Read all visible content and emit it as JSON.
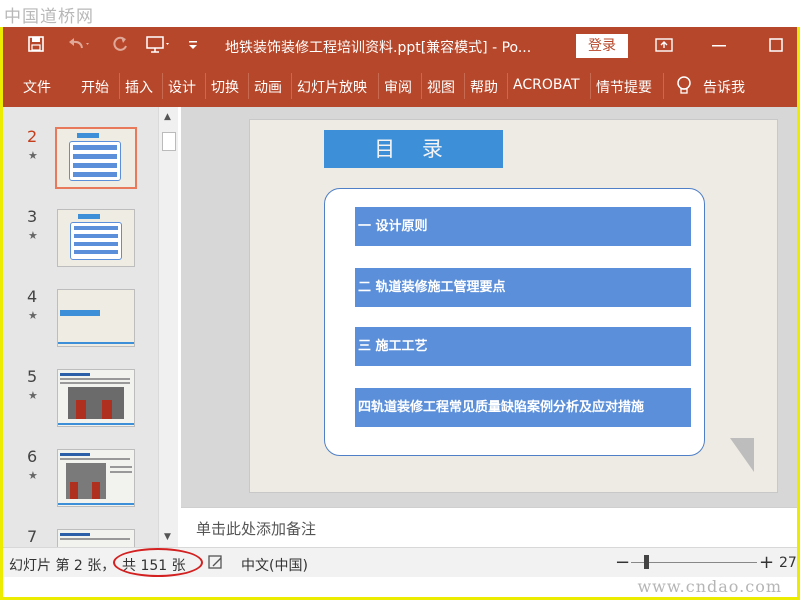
{
  "watermark_top": "中国道桥网",
  "watermark_bottom": "www.cndao.com",
  "titlebar": {
    "doc_title": "地铁装饰装修工程培训资料.ppt[兼容模式]  -  Po...",
    "login_label": "登录"
  },
  "ribbon": {
    "tabs": [
      "文件",
      "开始",
      "插入",
      "设计",
      "切换",
      "动画",
      "幻灯片放映",
      "审阅",
      "视图",
      "帮助",
      "ACROBAT",
      "情节提要"
    ],
    "tell_me": "告诉我"
  },
  "thumbnails": [
    {
      "num": "2",
      "active": true
    },
    {
      "num": "3",
      "active": false
    },
    {
      "num": "4",
      "active": false
    },
    {
      "num": "5",
      "active": false
    },
    {
      "num": "6",
      "active": false
    },
    {
      "num": "7",
      "active": false
    }
  ],
  "slide": {
    "title": "目  录",
    "items": [
      "一 设计原则",
      "二 轨道装修施工管理要点",
      "三 施工工艺",
      "四轨道装修工程常见质量缺陷案例分析及应对措施"
    ]
  },
  "notes_placeholder": "单击此处添加备注",
  "status": {
    "slide_label": "幻灯片 第 2 张，",
    "total_label": "共 151 张",
    "language": "中文(中国)",
    "zoom": "27"
  },
  "colors": {
    "accent": "#b7472a",
    "toc_fill": "#5b8fd9",
    "title_fill": "#3d8fd7",
    "highlight_circle": "#d32020"
  },
  "icons": [
    "save-icon",
    "undo-icon",
    "redo-icon",
    "present-icon",
    "customize-icon",
    "ribbon-display-icon",
    "minimize-icon",
    "maximize-icon",
    "lightbulb-icon",
    "notes-icon",
    "zoom-out-icon",
    "zoom-in-icon"
  ]
}
